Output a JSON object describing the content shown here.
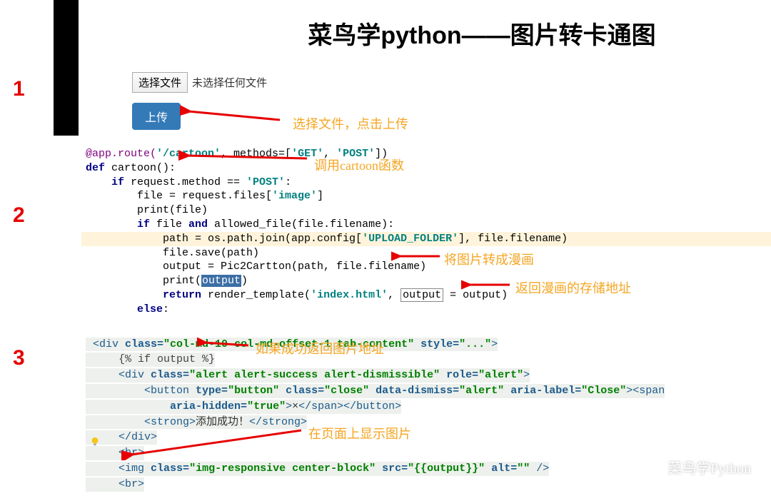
{
  "nums": {
    "n1": "1",
    "n2": "2",
    "n3": "3"
  },
  "title": "菜鸟学python——图片转卡通图",
  "upload": {
    "choose": "选择文件",
    "nofile": "未选择任何文件",
    "submit": "上传"
  },
  "annot": {
    "a1": "选择文件，点击上传",
    "a2": "调用cartoon函数",
    "a3": "将图片转成漫画",
    "a4": "返回漫画的存储地址",
    "a5": "如果成功返回图片地址",
    "a6": "在页面上显示图片"
  },
  "py": {
    "l1a": "@app.route(",
    "l1b": "'/cartoon'",
    "l1c": ", methods=[",
    "l1d": "'GET'",
    "l1e": ", ",
    "l1f": "'POST'",
    "l1g": "])",
    "l2a": "def",
    "l2b": " cartoon():",
    "l3a": "    if",
    "l3b": " request.method == ",
    "l3c": "'POST'",
    "l3d": ":",
    "l4a": "        file = request.files[",
    "l4b": "'image'",
    "l4c": "]",
    "l5": "        print(file)",
    "l6a": "        if",
    "l6b": " file ",
    "l6c": "and",
    "l6d": " allowed_file(file.filename):",
    "l7a": "            path = os.path.join(app.config[",
    "l7b": "'UPLOAD_FOLDER'",
    "l7c": "], file.filename)",
    "l8": "            file.save(path)",
    "l9": "            output = Pic2Cartton(path, file.filename)",
    "l10a": "            print(",
    "l10b": "output",
    "l10c": ")",
    "l11a": "            return",
    "l11b": " render_template(",
    "l11c": "'index.html'",
    "l11d": ", ",
    "l11e": "output",
    "l11f": " = output)",
    "l12a": "        else",
    "l12b": ":"
  },
  "html": {
    "l1": "<div class=\"col-md-10 col-md-offset-1 tab-content\" style=\"...\">",
    "l2": "    {% if output %}",
    "l3": "    <div class=\"alert alert-success alert-dismissible\" role=\"alert\">",
    "l4": "        <button type=\"button\" class=\"close\" data-dismiss=\"alert\" aria-label=\"Close\"><span",
    "l5": "            aria-hidden=\"true\">×</span></button>",
    "l6": "        <strong>添加成功！</strong>",
    "l7": "    </div>",
    "l8": "    <br>",
    "l9": "    <img class=\"img-responsive center-block\" src=\"{{output}}\" alt=\"\" />",
    "l10": "    <br>",
    "strong_txt": "添加成功！"
  },
  "watermark": "菜鸟学Python"
}
